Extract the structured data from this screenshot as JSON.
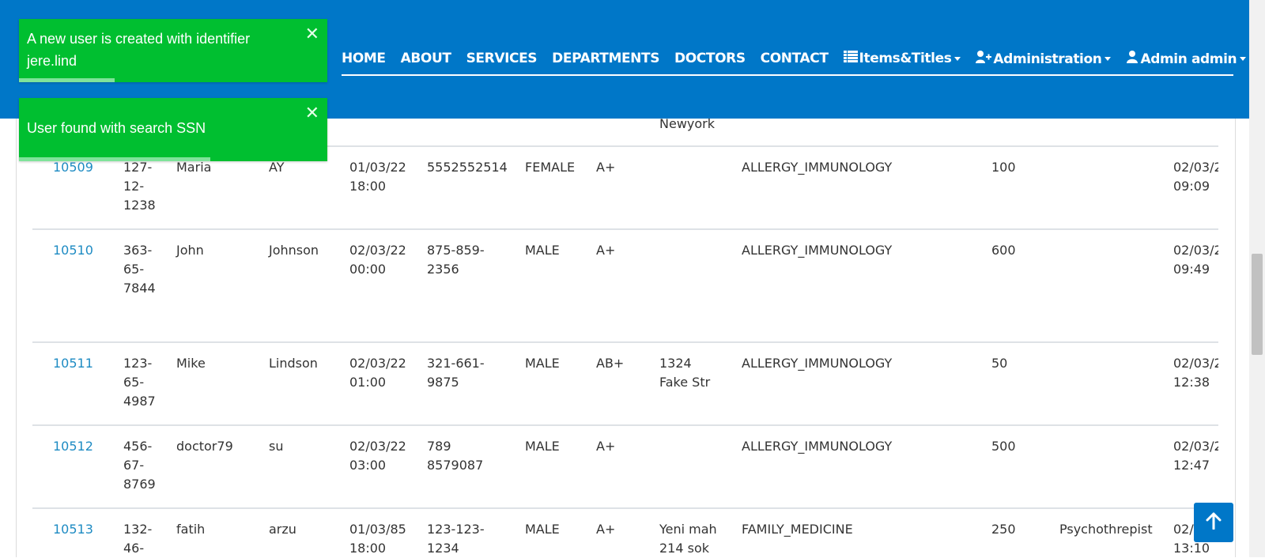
{
  "nav": {
    "home": "HOME",
    "about": "ABOUT",
    "services": "SERVICES",
    "departments": "DEPARTMENTS",
    "doctors": "DOCTORS",
    "contact": "CONTACT",
    "items_titles": "Items&Titles",
    "administration": "Administration",
    "account": "Admin admin"
  },
  "toasts": [
    {
      "message": "A new user is created with identifier jere.lind",
      "progress": 0.31
    },
    {
      "message": "User found with search SSN",
      "progress": 0.62
    }
  ],
  "partial_row": {
    "address": "Newyork"
  },
  "rows": [
    {
      "id": "10509",
      "ssn": "127-\n12-\n1238",
      "first_name": "Maria",
      "last_name": "AY",
      "birth_date": "01/03/22\n18:00",
      "phone": "5552552514",
      "gender": "FEMALE",
      "blood_group": "A+",
      "address": "",
      "speciality": "ALLERGY_IMMUNOLOGY",
      "exam_fee": "100",
      "description": "",
      "created": "02/03/2\n09:09"
    },
    {
      "id": "10510",
      "ssn": "363-\n65-\n7844",
      "first_name": "John",
      "last_name": "Johnson",
      "birth_date": "02/03/22\n00:00",
      "phone": "875-859-\n2356",
      "gender": "MALE",
      "blood_group": "A+",
      "address": "",
      "speciality": "ALLERGY_IMMUNOLOGY",
      "exam_fee": "600",
      "description": "",
      "created": "02/03/2\n09:49"
    },
    {
      "id": "10511",
      "ssn": "123-\n65-\n4987",
      "first_name": "Mike",
      "last_name": "Lindson",
      "birth_date": "02/03/22\n01:00",
      "phone": "321-661-\n9875",
      "gender": "MALE",
      "blood_group": "AB+",
      "address": "1324\nFake Str",
      "speciality": "ALLERGY_IMMUNOLOGY",
      "exam_fee": "50",
      "description": "",
      "created": "02/03/2\n12:38"
    },
    {
      "id": "10512",
      "ssn": "456-\n67-\n8769",
      "first_name": "doctor79",
      "last_name": "su",
      "birth_date": "02/03/22\n03:00",
      "phone": "789\n8579087",
      "gender": "MALE",
      "blood_group": "A+",
      "address": "",
      "speciality": "ALLERGY_IMMUNOLOGY",
      "exam_fee": "500",
      "description": "",
      "created": "02/03/2\n12:47"
    },
    {
      "id": "10513",
      "ssn": "132-\n46-",
      "first_name": "fatih",
      "last_name": "arzu",
      "birth_date": "01/03/85\n18:00",
      "phone": "123-123-\n1234",
      "gender": "MALE",
      "blood_group": "A+",
      "address": "Yeni mah\n214 sok",
      "speciality": "FAMILY_MEDICINE",
      "exam_fee": "250",
      "description": "Psychothrepist",
      "created": "02/\n13:10"
    }
  ],
  "colors": {
    "primary": "#0077c8",
    "toast": "#00bf30",
    "link": "#1e8bc3"
  }
}
